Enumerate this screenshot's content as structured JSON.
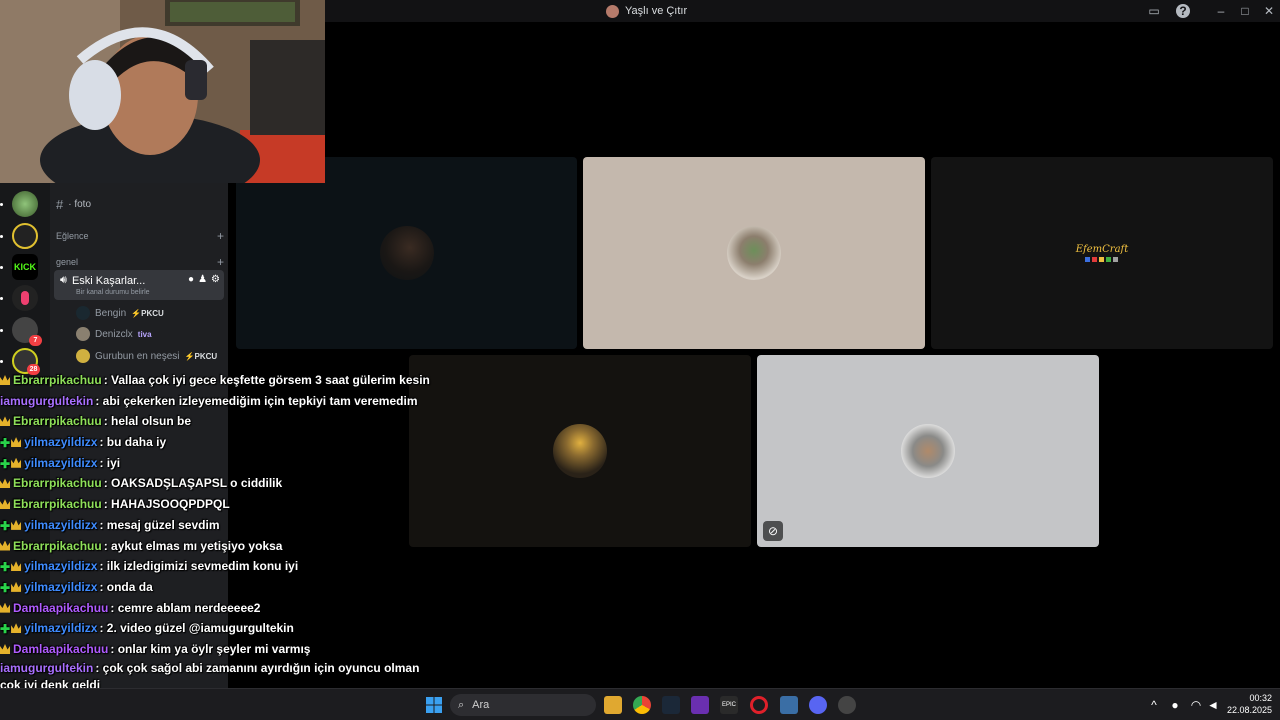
{
  "window": {
    "title": "Yaşlı ve Çıtır"
  },
  "sidebar": {
    "channel_foto": "· foto",
    "category_eglence": "Eğlence",
    "category_genel": "genel",
    "voice_channel": "Eski Kaşarlar...",
    "voice_status": "Bir kanal durumu belirle",
    "members": [
      {
        "name": "Bengin",
        "tag": "PKCU"
      },
      {
        "name": "Denizclx",
        "tag": "tiva"
      },
      {
        "name": "Gurubun en neşesi",
        "tag": "PKCU"
      }
    ],
    "server_badges": {
      "b1": "7",
      "b2": "28"
    }
  },
  "chat": [
    {
      "user": "Ebrarrpikachuu",
      "text": ": Vallaa çok iyi gece keşfette görsem 3 saat gülerim kesin",
      "color": "#8fe05a",
      "badges": [
        "crown"
      ]
    },
    {
      "user": "iamugurgultekin",
      "text": ": abi çekerken izleyemediğim için tepkiyi tam veremedim",
      "color": "#a970ff",
      "badges": []
    },
    {
      "user": "Ebrarrpikachuu",
      "text": ": helal olsun be",
      "color": "#8fe05a",
      "badges": [
        "crown"
      ]
    },
    {
      "user": "yilmazyildizx",
      "text": ": bu daha iy",
      "color": "#3f8cff",
      "badges": [
        "plus",
        "crown"
      ]
    },
    {
      "user": "yilmazyildizx",
      "text": ": iyi",
      "color": "#3f8cff",
      "badges": [
        "plus",
        "crown"
      ]
    },
    {
      "user": "Ebrarrpikachuu",
      "text": ": OAKSADŞLAŞAPSL o ciddilik",
      "color": "#8fe05a",
      "badges": [
        "crown"
      ]
    },
    {
      "user": "Ebrarrpikachuu",
      "text": ": HAHAJSOOQPDPQL",
      "color": "#8fe05a",
      "badges": [
        "crown"
      ]
    },
    {
      "user": "yilmazyildizx",
      "text": ": mesaj güzel sevdim",
      "color": "#3f8cff",
      "badges": [
        "plus",
        "crown"
      ]
    },
    {
      "user": "Ebrarrpikachuu",
      "text": ": aykut elmas mı yetişiyo yoksa",
      "color": "#8fe05a",
      "badges": [
        "crown"
      ]
    },
    {
      "user": "yilmazyildizx",
      "text": ": ilk izledigimizi sevmedim konu iyi",
      "color": "#3f8cff",
      "badges": [
        "plus",
        "crown"
      ]
    },
    {
      "user": "yilmazyildizx",
      "text": ": onda da",
      "color": "#3f8cff",
      "badges": [
        "plus",
        "crown"
      ]
    },
    {
      "user": "Damlaapikachuu",
      "text": ": cemre ablam nerdeeeee2",
      "color": "#b05cff",
      "badges": [
        "crown"
      ]
    },
    {
      "user": "yilmazyildizx",
      "text": ": 2. video güzel @iamugurgultekin",
      "color": "#3f8cff",
      "badges": [
        "plus",
        "crown"
      ]
    },
    {
      "user": "Damlaapikachuu",
      "text": ": onlar kim ya öylr şeyler mi varmış",
      "color": "#b05cff",
      "badges": [
        "crown"
      ]
    },
    {
      "user": "iamugurgultekin",
      "text": ": çok çok sağol abi zamanını ayırdığın için oyuncu olman çok iyi denk geldi",
      "color": "#a970ff",
      "badges": []
    }
  ],
  "stage": {
    "tile_label_efem": "EfemCraft"
  },
  "taskbar": {
    "search_placeholder": "Ara",
    "time": "00:32",
    "date": "22.08.2025"
  },
  "colors": {
    "titlebar": "#121214",
    "sidebar": "#1e1f22",
    "tile_beige": "#c4b8ad",
    "tile_grey": "#c4c5c7"
  }
}
